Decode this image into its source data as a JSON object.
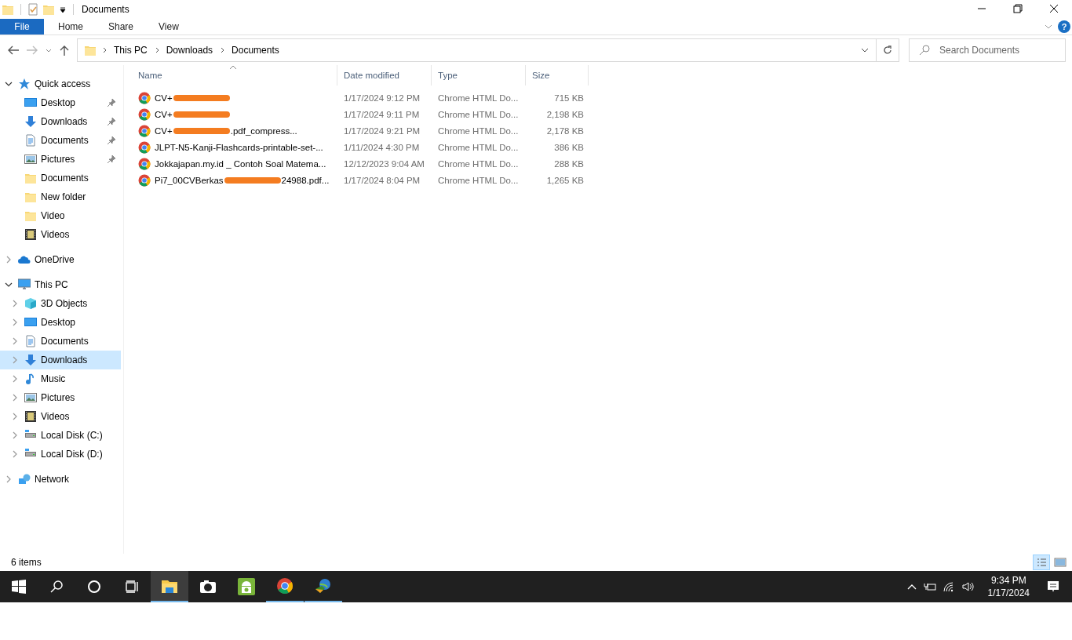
{
  "window": {
    "title": "Documents"
  },
  "ribbon": {
    "tabs": [
      {
        "label": "File",
        "kind": "file",
        "selected": false
      },
      {
        "label": "Home",
        "kind": "tab",
        "selected": false
      },
      {
        "label": "Share",
        "kind": "tab",
        "selected": false
      },
      {
        "label": "View",
        "kind": "tab",
        "selected": false
      }
    ],
    "help": "?"
  },
  "address": {
    "path": [
      "This PC",
      "Downloads",
      "Documents"
    ]
  },
  "search": {
    "placeholder": "Search Documents"
  },
  "sidebar": {
    "items": [
      {
        "label": "Quick access",
        "kind": "star",
        "expanded": true,
        "children": [
          {
            "label": "Desktop",
            "kind": "desktop",
            "pinned": true
          },
          {
            "label": "Downloads",
            "kind": "download",
            "pinned": true
          },
          {
            "label": "Documents",
            "kind": "document",
            "pinned": true
          },
          {
            "label": "Pictures",
            "kind": "picture",
            "pinned": true
          },
          {
            "label": "Documents",
            "kind": "folder",
            "pinned": false
          },
          {
            "label": "New folder",
            "kind": "folder",
            "pinned": false
          },
          {
            "label": "Video",
            "kind": "folder",
            "pinned": false
          },
          {
            "label": "Videos",
            "kind": "video",
            "pinned": false
          }
        ]
      },
      {
        "label": "OneDrive",
        "kind": "cloud",
        "expanded": false
      },
      {
        "label": "This PC",
        "kind": "pc",
        "expanded": true,
        "children": [
          {
            "label": "3D Objects",
            "kind": "cube",
            "expanded": false,
            "selected": false
          },
          {
            "label": "Desktop",
            "kind": "desktop",
            "expanded": false,
            "selected": false
          },
          {
            "label": "Documents",
            "kind": "document",
            "expanded": false,
            "selected": false
          },
          {
            "label": "Downloads",
            "kind": "download",
            "expanded": false,
            "selected": true
          },
          {
            "label": "Music",
            "kind": "music",
            "expanded": false,
            "selected": false
          },
          {
            "label": "Pictures",
            "kind": "picture",
            "expanded": false,
            "selected": false
          },
          {
            "label": "Videos",
            "kind": "video",
            "expanded": false,
            "selected": false
          },
          {
            "label": "Local Disk (C:)",
            "kind": "disk",
            "expanded": false,
            "selected": false
          },
          {
            "label": "Local Disk (D:)",
            "kind": "disk",
            "expanded": false,
            "selected": false
          }
        ]
      },
      {
        "label": "Network",
        "kind": "network",
        "expanded": false
      }
    ]
  },
  "table": {
    "columns": [
      {
        "label": "Name",
        "sorted": true
      },
      {
        "label": "Date modified",
        "sorted": false
      },
      {
        "label": "Type",
        "sorted": false
      },
      {
        "label": "Size",
        "sorted": false
      }
    ],
    "rows": [
      {
        "name": "CV+",
        "redacted": true,
        "name_end": "",
        "date": "1/17/2024 9:12 PM",
        "type": "Chrome HTML Do...",
        "size": "715 KB"
      },
      {
        "name": "CV+",
        "redacted": true,
        "name_end": "",
        "date": "1/17/2024 9:11 PM",
        "type": "Chrome HTML Do...",
        "size": "2,198 KB"
      },
      {
        "name": "CV+",
        "redacted": true,
        "name_end": ".pdf_compress...",
        "date": "1/17/2024 9:21 PM",
        "type": "Chrome HTML Do...",
        "size": "2,178 KB"
      },
      {
        "name": "JLPT-N5-Kanji-Flashcards-printable-set-...",
        "redacted": false,
        "name_end": "",
        "date": "1/11/2024 4:30 PM",
        "type": "Chrome HTML Do...",
        "size": "386 KB"
      },
      {
        "name": "Jokkajapan.my.id _ Contoh Soal Matema...",
        "redacted": false,
        "name_end": "",
        "date": "12/12/2023 9:04 AM",
        "type": "Chrome HTML Do...",
        "size": "288 KB"
      },
      {
        "name": "Pi7_00CVBerkas",
        "redacted": true,
        "name_end": "24988.pdf...",
        "date": "1/17/2024 8:04 PM",
        "type": "Chrome HTML Do...",
        "size": "1,265 KB"
      }
    ]
  },
  "status_bar": {
    "count": "6 items",
    "views": [
      {
        "kind": "details",
        "selected": true
      },
      {
        "kind": "large",
        "selected": false
      }
    ]
  },
  "taskbar": {
    "apps": [
      {
        "kind": "explorer",
        "running": true,
        "selected": true
      },
      {
        "kind": "camera",
        "running": false,
        "selected": false
      },
      {
        "kind": "android",
        "running": false,
        "selected": false
      },
      {
        "kind": "chrome",
        "running": true,
        "selected": false
      },
      {
        "kind": "downloader",
        "running": true,
        "selected": false
      }
    ],
    "time": "9:34 PM",
    "date": "1/17/2024"
  }
}
